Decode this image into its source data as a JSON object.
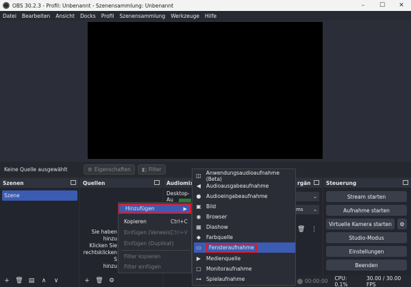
{
  "window": {
    "title": "OBS 30.2.3 - Profil: Unbenannt - Szenensammlung: Unbenannt"
  },
  "menu": [
    "Datei",
    "Bearbeiten",
    "Ansicht",
    "Docks",
    "Profil",
    "Szenensammlung",
    "Werkzeuge",
    "Hilfe"
  ],
  "context_bar": {
    "no_source": "Keine Quelle ausgewählt",
    "properties": "Eigenschaften",
    "filter": "Filter"
  },
  "docks": {
    "scenes": {
      "title": "Szenen",
      "items": [
        "Szene"
      ]
    },
    "sources": {
      "title": "Quellen",
      "hint_lines": [
        "Sie haben",
        "hinzu",
        "Klicken Sie",
        "rechtsklicken S",
        "hinzu"
      ]
    },
    "audio": {
      "title": "Audiomixe",
      "device": "Desktop-Au"
    },
    "transitions": {
      "title": "rgän",
      "duration_suffix": "ms"
    },
    "controls": {
      "title": "Steuerung",
      "buttons": [
        "Stream starten",
        "Aufnahme starten",
        "Virtuelle Kamera starten",
        "Studio-Modus",
        "Einstellungen",
        "Beenden"
      ]
    }
  },
  "context_menu": {
    "items": [
      {
        "label": "Hinzufügen",
        "shortcut": "",
        "state": "highlighted"
      },
      {
        "label": "Kopieren",
        "shortcut": "Ctrl+C",
        "state": "normal"
      },
      {
        "label": "Einfügen (Verweis)",
        "shortcut": "Ctrl+V",
        "state": "disabled"
      },
      {
        "label": "Einfügen (Duplikat)",
        "shortcut": "",
        "state": "disabled"
      },
      {
        "label": "Filter kopieren",
        "shortcut": "",
        "state": "disabled"
      },
      {
        "label": "Filter einfügen",
        "shortcut": "",
        "state": "disabled"
      }
    ]
  },
  "submenu": {
    "items": [
      {
        "label": "Anwendungsaudioaufnahme (Beta)",
        "icon": "app-audio-icon"
      },
      {
        "label": "Audioausgabeaufnahme",
        "icon": "speaker-icon"
      },
      {
        "label": "Audioeingabeaufnahme",
        "icon": "microphone-icon"
      },
      {
        "label": "Bild",
        "icon": "image-icon"
      },
      {
        "label": "Browser",
        "icon": "globe-icon"
      },
      {
        "label": "Diashow",
        "icon": "slideshow-icon"
      },
      {
        "label": "Farbquelle",
        "icon": "paint-bucket-icon"
      },
      {
        "label": "Fensteraufnahme",
        "icon": "window-icon"
      },
      {
        "label": "Medienquelle",
        "icon": "play-icon"
      },
      {
        "label": "Monitoraufnahme",
        "icon": "monitor-icon"
      },
      {
        "label": "Spielaufnahme",
        "icon": "gamepad-icon"
      }
    ],
    "highlighted": "Fensteraufnahme"
  },
  "status": {
    "time": "00:00:00",
    "cpu": "CPU: 0.1%",
    "fps": "30.00 / 30.00 FPS"
  },
  "colors": {
    "accent": "#3c5bb2",
    "highlight_border": "#e0182a",
    "panel": "#22252d"
  }
}
